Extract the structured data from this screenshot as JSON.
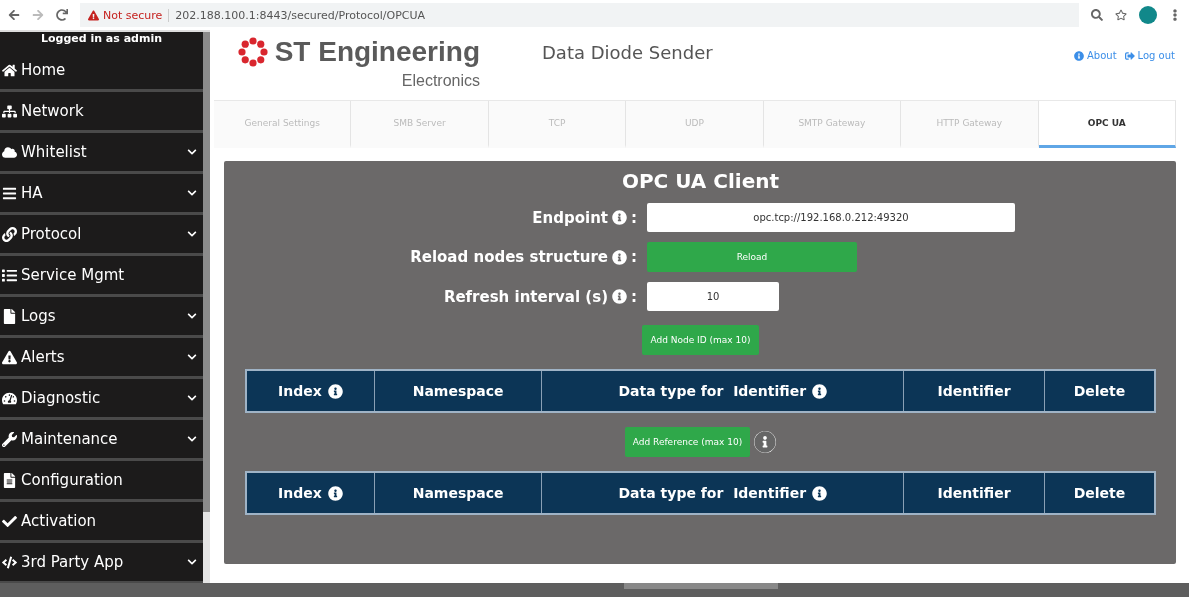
{
  "browser": {
    "security_warning": "Not secure",
    "url": "202.188.100.1:8443/secured/Protocol/OPCUA"
  },
  "sidebar": {
    "user_label": "Logged in as admin",
    "items": [
      {
        "label": "Home",
        "expandable": false
      },
      {
        "label": "Network",
        "expandable": false
      },
      {
        "label": "Whitelist",
        "expandable": true
      },
      {
        "label": "HA",
        "expandable": true
      },
      {
        "label": "Protocol",
        "expandable": true
      },
      {
        "label": "Service Mgmt",
        "expandable": false
      },
      {
        "label": "Logs",
        "expandable": true
      },
      {
        "label": "Alerts",
        "expandable": true
      },
      {
        "label": "Diagnostic",
        "expandable": true
      },
      {
        "label": "Maintenance",
        "expandable": true
      },
      {
        "label": "Configuration",
        "expandable": false
      },
      {
        "label": "Activation",
        "expandable": false
      },
      {
        "label": "3rd Party App",
        "expandable": true
      }
    ]
  },
  "header": {
    "logo_name": "ST Engineering",
    "logo_sub": "Electronics",
    "title": "Data Diode Sender",
    "links": [
      "About",
      "Log out"
    ]
  },
  "tabs": [
    {
      "label": "General Settings",
      "selected": false
    },
    {
      "label": "SMB Server",
      "selected": false
    },
    {
      "label": "TCP",
      "selected": false
    },
    {
      "label": "UDP",
      "selected": false
    },
    {
      "label": "SMTP Gateway",
      "selected": false
    },
    {
      "label": "HTTP Gateway",
      "selected": false
    },
    {
      "label": "OPC UA",
      "selected": true
    }
  ],
  "panel": {
    "title": "OPC UA Client",
    "fields": [
      {
        "kind": "input",
        "label": "Endpoint",
        "info": true,
        "suffix": ":",
        "value": "opc.tcp://192.168.0.212:49320"
      },
      {
        "kind": "button",
        "label": "Reload nodes structure",
        "info": true,
        "suffix": ":",
        "value": "Reload"
      },
      {
        "kind": "short_input",
        "label": "Refresh interval (s)",
        "info": true,
        "suffix": ":",
        "value": "10"
      }
    ],
    "add_node_button": "Add Node ID (max 10)",
    "node_table": {
      "columns": [
        {
          "label": "Index",
          "info": true
        },
        {
          "label": "Namespace",
          "info": false
        },
        {
          "label": "Data type for  Identifier",
          "info": true
        },
        {
          "label": "Identifier",
          "info": false
        },
        {
          "label": "Delete",
          "info": false
        }
      ]
    },
    "add_reference_button": {
      "label": "Add Reference (max 10)",
      "info": true
    },
    "reference_table": {
      "columns": [
        {
          "label": "Index",
          "info": true
        },
        {
          "label": "Namespace",
          "info": false
        },
        {
          "label": "Data type for  Identifier",
          "info": true
        },
        {
          "label": "Identifier",
          "info": false
        },
        {
          "label": "Delete",
          "info": false
        }
      ]
    }
  }
}
